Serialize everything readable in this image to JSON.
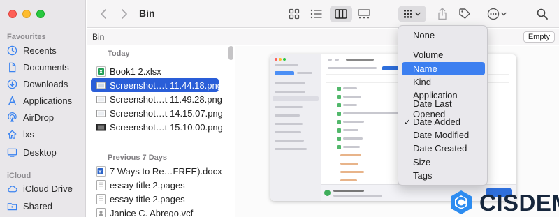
{
  "window": {
    "title": "Bin"
  },
  "sidebar": {
    "favourites_label": "Favourites",
    "favourites": [
      {
        "label": "Recents",
        "icon": "clock-icon"
      },
      {
        "label": "Documents",
        "icon": "document-icon"
      },
      {
        "label": "Downloads",
        "icon": "download-icon"
      },
      {
        "label": "Applications",
        "icon": "applications-icon"
      },
      {
        "label": "AirDrop",
        "icon": "airdrop-icon"
      },
      {
        "label": "lxs",
        "icon": "home-icon"
      },
      {
        "label": "Desktop",
        "icon": "desktop-icon"
      }
    ],
    "icloud_label": "iCloud",
    "icloud": [
      {
        "label": "iCloud Drive",
        "icon": "cloud-icon"
      },
      {
        "label": "Shared",
        "icon": "shared-folder-icon"
      }
    ]
  },
  "pathbar": {
    "title": "Bin",
    "empty_label": "Empty"
  },
  "filelist": {
    "today_label": "Today",
    "today": [
      {
        "name": "Book1 2.xlsx",
        "icon": "excel-file-icon",
        "selected": false
      },
      {
        "name": "Screenshot…t 11.44.18.png",
        "icon": "image-file-icon",
        "selected": true
      },
      {
        "name": "Screenshot…t 11.49.28.png",
        "icon": "image-file-icon",
        "selected": false
      },
      {
        "name": "Screenshot…t 14.15.07.png",
        "icon": "image-file-icon",
        "selected": false
      },
      {
        "name": "Screenshot…t 15.10.00.png",
        "icon": "image-file-icon",
        "selected": false
      }
    ],
    "previous_label": "Previous 7 Days",
    "previous": [
      {
        "name": "7 Ways to Re…FREE).docx",
        "icon": "word-file-icon"
      },
      {
        "name": "essay title 2.pages",
        "icon": "pages-file-icon"
      },
      {
        "name": "essay title 2.pages",
        "icon": "pages-file-icon"
      },
      {
        "name": "Janice C. Abrego.vcf",
        "icon": "vcard-file-icon"
      }
    ]
  },
  "sort_menu": {
    "items": [
      {
        "label": "None",
        "checked": false,
        "highlighted": false
      },
      {
        "label": "Volume",
        "checked": false,
        "highlighted": false
      },
      {
        "label": "Name",
        "checked": false,
        "highlighted": true
      },
      {
        "label": "Kind",
        "checked": false,
        "highlighted": false
      },
      {
        "label": "Application",
        "checked": false,
        "highlighted": false
      },
      {
        "label": "Date Last Opened",
        "checked": false,
        "highlighted": false
      },
      {
        "label": "Date Added",
        "checked": true,
        "highlighted": false
      },
      {
        "label": "Date Modified",
        "checked": false,
        "highlighted": false
      },
      {
        "label": "Date Created",
        "checked": false,
        "highlighted": false
      },
      {
        "label": "Size",
        "checked": false,
        "highlighted": false
      },
      {
        "label": "Tags",
        "checked": false,
        "highlighted": false
      }
    ],
    "check_glyph": "✓"
  },
  "watermark": {
    "text": "CISDEM"
  },
  "colors": {
    "selection": "#2a5ed8",
    "menu_highlight": "#3c7ff0",
    "accent": "#2d8cf0"
  }
}
